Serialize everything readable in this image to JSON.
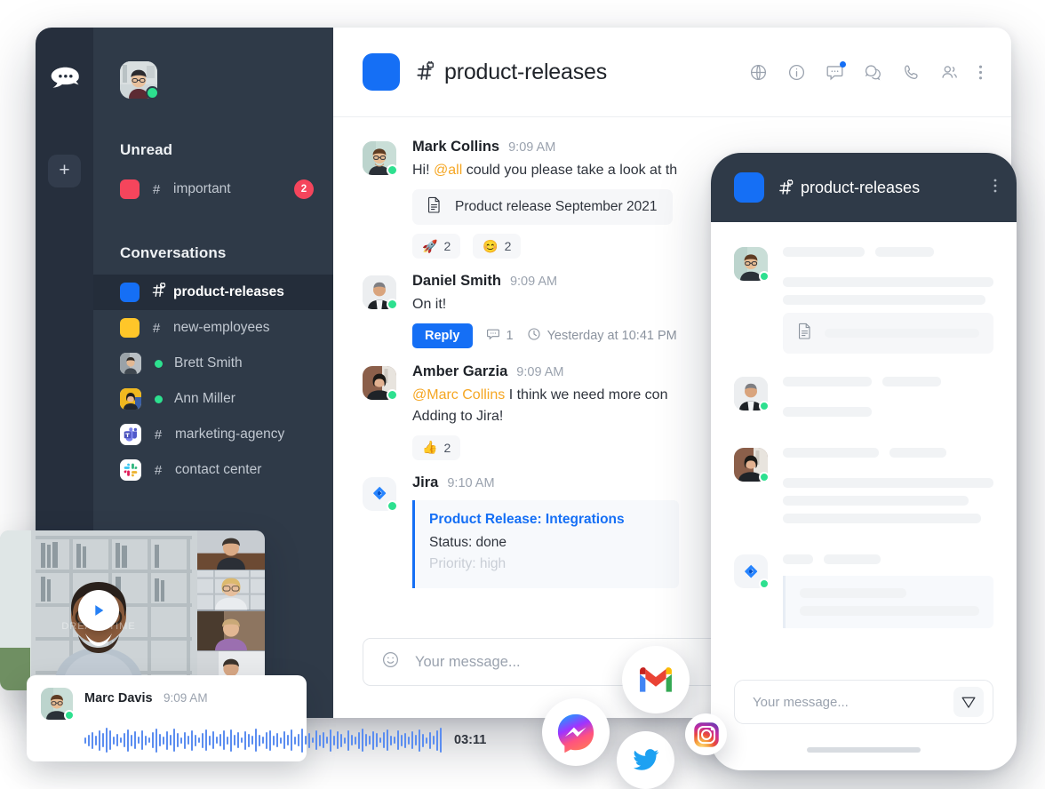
{
  "app": {
    "logo_icon": "rocketchat-logo-icon",
    "add_button_label": "+"
  },
  "sidebar": {
    "user_avatar": "user-avatar",
    "user_status": "online",
    "sections": [
      {
        "title": "Unread"
      },
      {
        "title": "Conversations"
      }
    ],
    "unread_items": [
      {
        "name": "important",
        "prefix": "#",
        "badge": "2",
        "swatch": "#f5455c",
        "kind": "channel"
      }
    ],
    "conversations": [
      {
        "name": "product-releases",
        "prefix": "#",
        "swatch": "#156ff5",
        "kind": "private-channel",
        "active": true
      },
      {
        "name": "new-employees",
        "prefix": "#",
        "swatch": "#ffc629",
        "kind": "channel",
        "active": false
      },
      {
        "name": "Brett Smith",
        "prefix": "",
        "kind": "direct",
        "status": "online",
        "active": false
      },
      {
        "name": "Ann Miller",
        "prefix": "",
        "kind": "direct",
        "status": "online",
        "active": false
      },
      {
        "name": "marketing-agency",
        "prefix": "#",
        "kind": "teams-channel",
        "active": false
      },
      {
        "name": "contact center",
        "prefix": "#",
        "kind": "slack-channel",
        "active": false
      }
    ]
  },
  "chat": {
    "room_name": "product-releases",
    "room_swatch": "#156ff5",
    "header_icons": [
      "globe-icon",
      "info-icon",
      "discussion-icon",
      "threads-icon",
      "phone-icon",
      "members-icon",
      "kebab-menu-icon"
    ],
    "messages": [
      {
        "author": "Mark Collins",
        "time": "9:09 AM",
        "text_before_mention": "Hi! ",
        "mention": "@all",
        "text_after_mention": " could you please take a look at th",
        "attachment": {
          "icon": "document-icon",
          "name": "Product release September 2021"
        },
        "reactions": [
          {
            "emoji": "🚀",
            "count": "2"
          },
          {
            "emoji": "😊",
            "count": "2"
          }
        ]
      },
      {
        "author": "Daniel Smith",
        "time": "9:09 AM",
        "text": "On it!",
        "reply_label": "Reply",
        "thread_count": "1",
        "thread_time": "Yesterday at 10:41 PM"
      },
      {
        "author": "Amber Garzia",
        "time": "9:09 AM",
        "mention": "@Marc Collins",
        "text_after_mention": " I think we need more con",
        "line2": "Adding to Jira!",
        "reactions": [
          {
            "emoji": "👍",
            "count": "2"
          }
        ]
      },
      {
        "author": "Jira",
        "time": "9:10 AM",
        "card": {
          "title": "Product Release: Integrations",
          "status": "Status: done",
          "priority": "Priority: high"
        }
      }
    ],
    "composer": {
      "emoji_icon": "emoji-icon",
      "placeholder": "Your message..."
    }
  },
  "phone": {
    "room_name": "product-releases",
    "room_swatch": "#156ff5",
    "kebab": "kebab-menu-icon",
    "composer": {
      "placeholder": "Your message...",
      "send_icon": "send-icon"
    }
  },
  "video_card": {
    "play_icon": "play-icon",
    "watermark": "DREAMSTIME"
  },
  "audio_card": {
    "author": "Marc Davis",
    "time": "9:09 AM",
    "duration": "03:11",
    "waveform": [
      7,
      13,
      19,
      11,
      23,
      16,
      28,
      22,
      9,
      14,
      6,
      16,
      25,
      13,
      20,
      8,
      22,
      11,
      6,
      18,
      27,
      14,
      9,
      21,
      12,
      26,
      16,
      7,
      19,
      10,
      23,
      13,
      6,
      17,
      24,
      11,
      20,
      8,
      14,
      22,
      9,
      25,
      12,
      18,
      6,
      21,
      15,
      10,
      26,
      13,
      8,
      19,
      23,
      11,
      16,
      7,
      20,
      12,
      24,
      9,
      14,
      27,
      10,
      17,
      6,
      22,
      13,
      18,
      8,
      25,
      11,
      20,
      15,
      7,
      23,
      12,
      9,
      19,
      26,
      14,
      10,
      21,
      16,
      6,
      18,
      24,
      11,
      8,
      22,
      13,
      17,
      9,
      20,
      12,
      25,
      15,
      7,
      19,
      10,
      23,
      28
    ]
  },
  "social_bubbles": [
    {
      "name": "gmail-icon"
    },
    {
      "name": "messenger-icon"
    },
    {
      "name": "twitter-icon"
    },
    {
      "name": "instagram-icon"
    }
  ],
  "colors": {
    "accent": "#156ff5",
    "danger": "#f5455c",
    "online": "#2de08f",
    "sidebar_bg": "#2f3a48",
    "rail_bg": "#262f3d",
    "mention": "#f5a623"
  }
}
